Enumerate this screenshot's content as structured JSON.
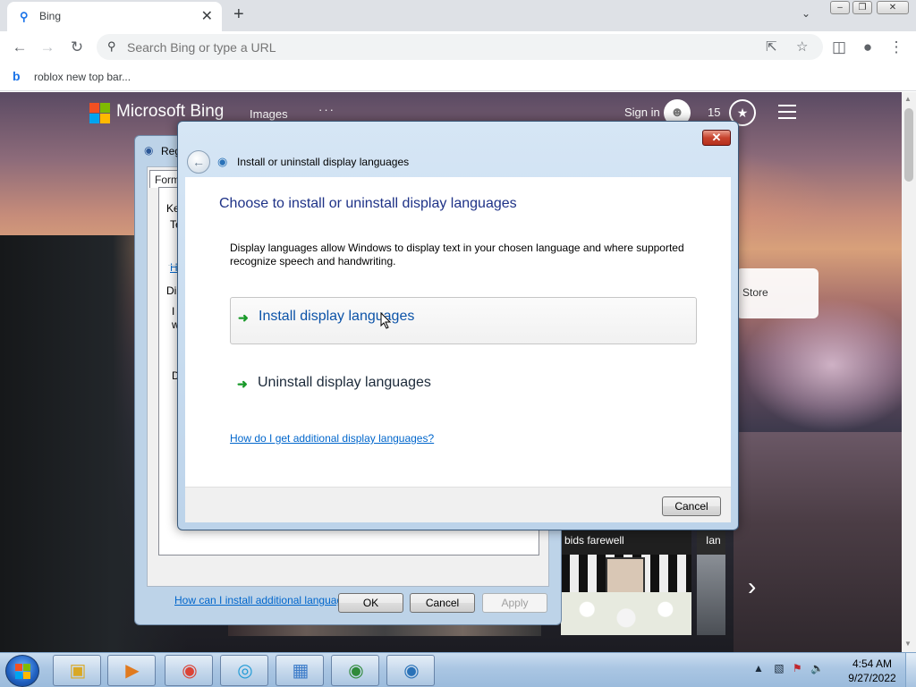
{
  "browser": {
    "tab": {
      "title": "Bing"
    },
    "omnibox": {
      "placeholder": "Search Bing or type a URL"
    },
    "bookmarks": [
      {
        "label": "roblox new top bar..."
      }
    ]
  },
  "bing": {
    "logo_text": "Microsoft Bing",
    "nav_images": "Images",
    "nav_more": "···",
    "sign_in": "Sign in",
    "points": "15",
    "store_card": "Store",
    "news": [
      {
        "headline": "bids farewell"
      },
      {
        "headline": "Ian"
      }
    ]
  },
  "region_dialog": {
    "title_fragment": "Reg",
    "tab_fragment": "Forma",
    "fragments": {
      "ke": "Ke",
      "te": "Te",
      "h": "H",
      "di": "Di",
      "i": "I",
      "w": "w",
      "d": "D"
    },
    "help_link": "How can I install additional languages?",
    "buttons": {
      "ok": "OK",
      "cancel": "Cancel",
      "apply": "Apply"
    }
  },
  "dialog": {
    "title": "Install or uninstall display languages",
    "heading": "Choose to install or uninstall display languages",
    "description": "Display languages allow Windows to display text in your chosen language and where supported recognize speech and handwriting.",
    "options": [
      {
        "label": "Install display languages"
      },
      {
        "label": "Uninstall display languages"
      }
    ],
    "more_link": "How do I get additional display languages?",
    "cancel": "Cancel"
  },
  "taskbar": {
    "clock_time": "4:54 AM",
    "clock_date": "9/27/2022"
  },
  "colors": {
    "link": "#0066cc",
    "heading": "#1e3287",
    "command_link": "#0c53a8",
    "arrow_green": "#1a9a2a"
  }
}
